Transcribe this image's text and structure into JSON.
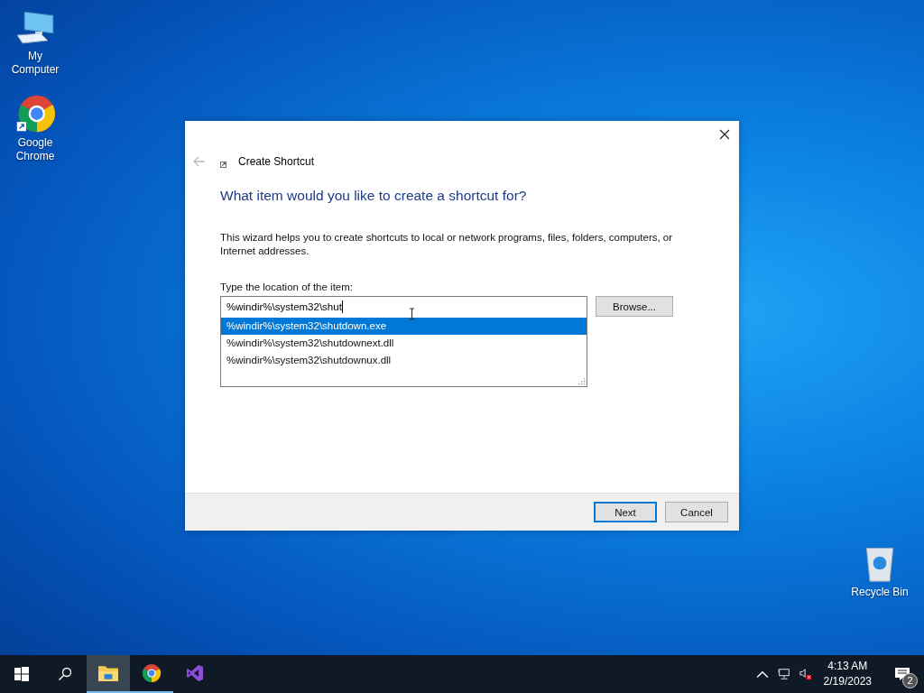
{
  "desktop_icons": [
    {
      "kind": "computer",
      "label": "My Computer"
    },
    {
      "kind": "chrome",
      "label": "Google Chrome"
    },
    {
      "kind": "recycle",
      "label": "Recycle Bin"
    }
  ],
  "dialog": {
    "title": "Create Shortcut",
    "heading": "What item would you like to create a shortcut for?",
    "description": "This wizard helps you to create shortcuts to local or network programs, files, folders, computers, or Internet addresses.",
    "field_label": "Type the location of the item:",
    "location_value": "%windir%\\system32\\shut",
    "suggestions": [
      {
        "text": "%windir%\\system32\\shutdown.exe",
        "selected": true
      },
      {
        "text": "%windir%\\system32\\shutdownext.dll",
        "selected": false
      },
      {
        "text": "%windir%\\system32\\shutdownux.dll",
        "selected": false
      }
    ],
    "browse_button": "Browse...",
    "buttons": [
      {
        "label": "Next",
        "default": true
      },
      {
        "label": "Cancel",
        "default": false
      }
    ]
  },
  "taskbar": {
    "apps": [
      {
        "kind": "explorer",
        "active": true,
        "running": true
      },
      {
        "kind": "chrome",
        "active": false,
        "running": true
      },
      {
        "kind": "vs",
        "active": false,
        "running": false
      }
    ],
    "time": "4:13 AM",
    "date": "2/19/2023",
    "notifications": "2"
  }
}
